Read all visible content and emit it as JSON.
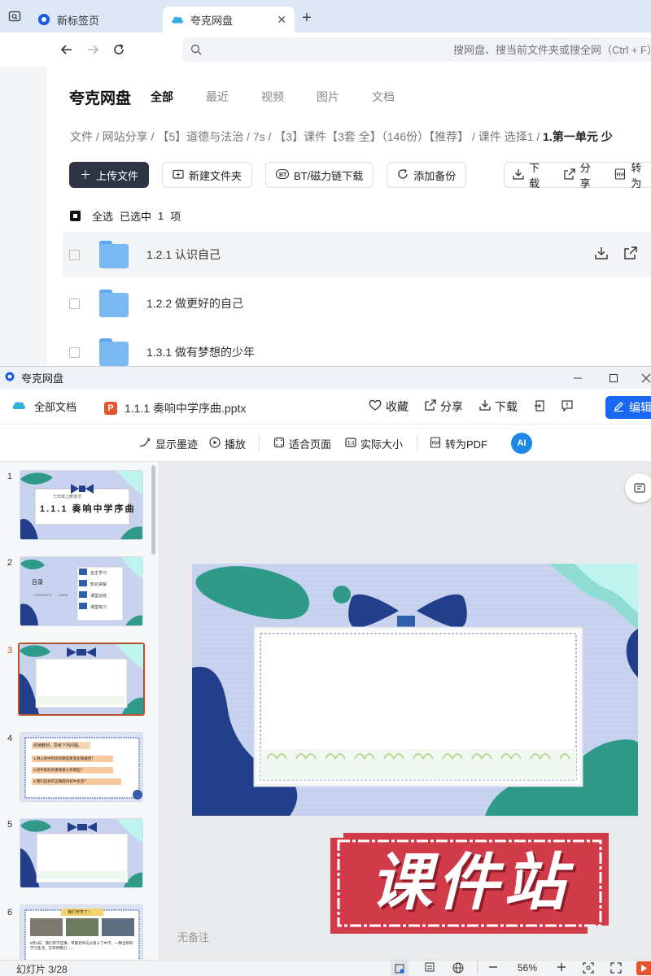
{
  "browser": {
    "tabs": [
      {
        "title": "新标签页",
        "active": false
      },
      {
        "title": "夸克网盘",
        "active": true
      }
    ],
    "new_tab": "+",
    "address_placeholder": "搜网盘、搜当前文件夹或搜全网（Ctrl + F）"
  },
  "netdisk": {
    "brand": "夸克网盘",
    "filter_tabs": [
      "全部",
      "最近",
      "视频",
      "图片",
      "文档"
    ],
    "breadcrumb": [
      "文件",
      "网站分享",
      "【5】道德与法治",
      "7s",
      "【3】课件【3套 全】（146份）【推荐】",
      "课件 选择1"
    ],
    "breadcrumb_last": "1.第一单元 少",
    "actions": [
      {
        "icon": "plus",
        "label": "上传文件"
      },
      {
        "icon": "folder-plus",
        "label": "新建文件夹"
      },
      {
        "icon": "bt",
        "label": "BT/磁力链下载"
      },
      {
        "icon": "refresh",
        "label": "添加备份"
      }
    ],
    "right_actions": [
      {
        "icon": "download",
        "label": "下载"
      },
      {
        "icon": "share",
        "label": "分享"
      },
      {
        "icon": "pdf",
        "label": "转为"
      }
    ],
    "select_all": "全选",
    "selected_prefix": "已选中",
    "selected_count": "1",
    "selected_unit": "项",
    "files": [
      "1.2.1 认识自己",
      "1.2.2 做更好的自己",
      "1.3.1 做有梦想的少年"
    ]
  },
  "preview": {
    "window_title": "夸克网盘",
    "all_docs": "全部文档",
    "ppt_badge": "P",
    "doc_name": "1.1.1 奏响中学序曲.pptx",
    "doc_actions": [
      "收藏",
      "分享",
      "下载"
    ],
    "edit_label": "编辑",
    "view_items": [
      "显示墨迹",
      "播放",
      "适合页面",
      "实际大小",
      "转为PDF"
    ],
    "ai_label": "AI",
    "thumb_numbers": [
      "1",
      "2",
      "3",
      "4",
      "5",
      "6"
    ],
    "thumb1_title": "1.1.1 奏响中学序曲",
    "thumb1_small": "七年级上册道法",
    "thumb2": {
      "heading": "目录",
      "sub1": "CONTENTS",
      "sub2": "PAGE",
      "items": [
        "自主学习",
        "知识讲解",
        "课堂总结",
        "课堂练习"
      ]
    },
    "thumb4": {
      "title": "阅读教材，思考下列问题。",
      "items": [
        "1.进入初中阶段有哪些新变化和展望？",
        "2.初中阶段的重要意义有哪些？",
        "3.我们应如何正确面对初中生活？"
      ]
    },
    "thumb6": {
      "title": "我们开学了！",
      "text": "9月1日，我们开学还课，带着老师与父母入了中学，一种全新的学习生活，在等待我们……"
    },
    "notes": "无备注",
    "stamp_text": "课件站",
    "slide_counter": "幻灯片 3/28",
    "zoom": "56%"
  },
  "colors": {
    "slide_bg": "#c8d3ef",
    "teal": "#2f9a8a",
    "navy": "#233f8c",
    "mint": "#bff3ee",
    "stamp_red": "#d23b4a",
    "edit_blue": "#1a67f2"
  }
}
